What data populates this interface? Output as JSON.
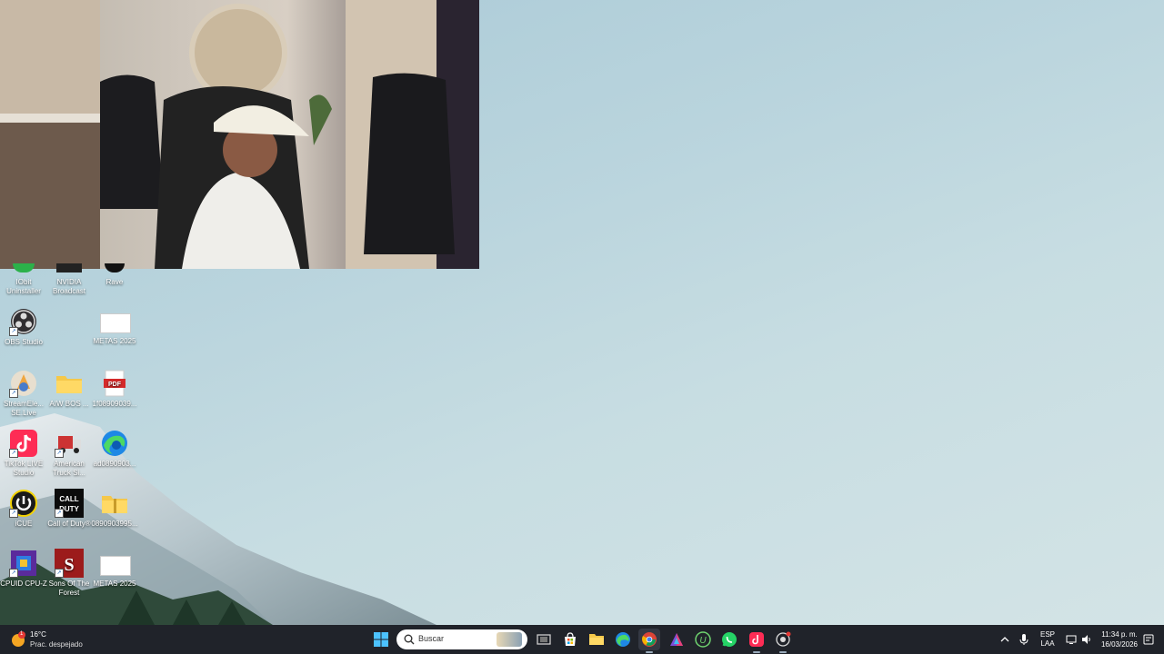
{
  "webcam": {
    "label": "Webcam overlay"
  },
  "desktop_icons": [
    {
      "name": "IObit Uninstaller"
    },
    {
      "name": "NVIDIA Broadcast"
    },
    {
      "name": "Rave"
    },
    {
      "name": "OBS Studio"
    },
    {
      "name": "METAS 2025"
    },
    {
      "name": "StreamEle... SE.Live"
    },
    {
      "name": "AIW BOS ..."
    },
    {
      "name": "1f08909039..."
    },
    {
      "name": "TikTok LIVE Studio"
    },
    {
      "name": "American Truck Si..."
    },
    {
      "name": "ad0890903..."
    },
    {
      "name": "iCUE"
    },
    {
      "name": "Call of Duty®"
    },
    {
      "name": "0890903995..."
    },
    {
      "name": "CPUID CPU-Z"
    },
    {
      "name": "Sons Of The Forest"
    },
    {
      "name": "METAS 2025"
    }
  ],
  "taskbar": {
    "weather": {
      "temp": "16°C",
      "condition": "Prac. despejado",
      "badge": "1"
    },
    "search": {
      "placeholder": "Buscar"
    },
    "tray": {
      "language": "ESP",
      "layout": "LAA",
      "time": "11:34 p. m.",
      "date": "16/03/2026"
    }
  },
  "colors": {
    "taskbar_bg": "#20232a",
    "accent": "#0078d4"
  }
}
